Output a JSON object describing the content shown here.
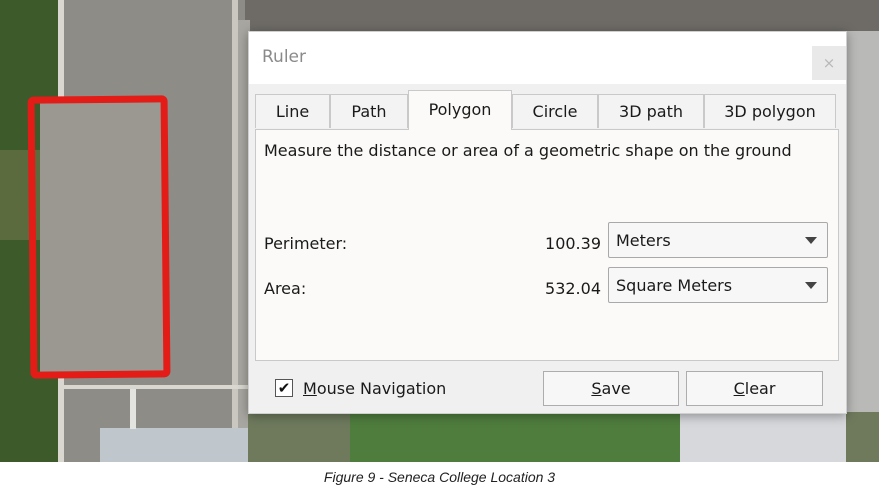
{
  "window": {
    "title": "Ruler",
    "close_glyph": "×"
  },
  "tabs": [
    {
      "label": "Line",
      "active": false
    },
    {
      "label": "Path",
      "active": false
    },
    {
      "label": "Polygon",
      "active": true
    },
    {
      "label": "Circle",
      "active": false
    },
    {
      "label": "3D path",
      "active": false
    },
    {
      "label": "3D polygon",
      "active": false
    }
  ],
  "description": "Measure the distance or area of a geometric shape on the ground",
  "measurements": {
    "perimeter": {
      "label": "Perimeter:",
      "value": "100.39",
      "unit": "Meters"
    },
    "area": {
      "label": "Area:",
      "value": "532.04",
      "unit": "Square Meters"
    }
  },
  "mouse_navigation": {
    "checked": true,
    "check_glyph": "✔",
    "label_first": "M",
    "label_rest": "ouse Navigation"
  },
  "buttons": {
    "save": {
      "first": "S",
      "rest": "ave"
    },
    "clear": {
      "first": "C",
      "rest": "lear"
    }
  },
  "caption": "Figure 9 - Seneca College Location 3",
  "colors": {
    "outline": "#e31c18",
    "dialog_bg": "#f0f0f0",
    "panel_bg": "#fbfaf8"
  },
  "icons": [
    "close-icon",
    "dropdown-arrow-icon",
    "checkbox-check-icon"
  ]
}
